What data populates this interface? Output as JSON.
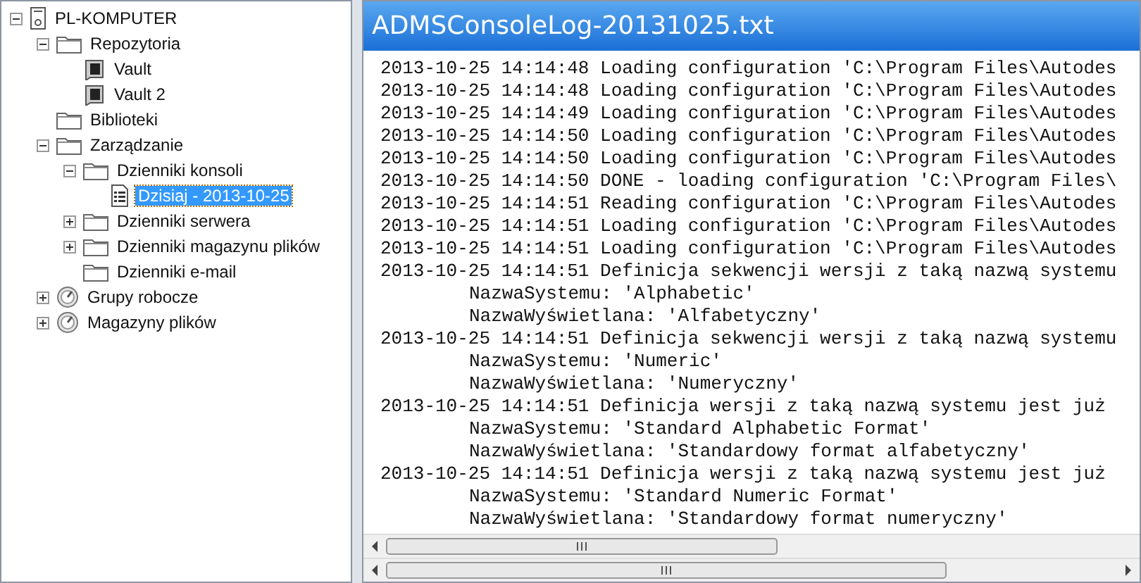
{
  "tree": [
    {
      "label": "PL-KOMPUTER",
      "kind": "computer",
      "expanded": true,
      "selected": false,
      "children": [
        {
          "label": "Repozytoria",
          "kind": "folder",
          "expanded": true,
          "selected": false,
          "children": [
            {
              "label": "Vault",
              "kind": "vault",
              "selected": false
            },
            {
              "label": "Vault 2",
              "kind": "vault",
              "selected": false
            }
          ]
        },
        {
          "label": "Biblioteki",
          "kind": "folder",
          "selected": false
        },
        {
          "label": "Zarządzanie",
          "kind": "folder",
          "expanded": true,
          "selected": false,
          "children": [
            {
              "label": "Dzienniki konsoli",
              "kind": "folder",
              "expanded": true,
              "selected": false,
              "children": [
                {
                  "label": "Dzisiaj - 2013-10-25",
                  "kind": "log",
                  "selected": true
                }
              ]
            },
            {
              "label": "Dzienniki serwera",
              "kind": "folder",
              "expanded": false,
              "selected": false
            },
            {
              "label": "Dzienniki magazynu plików",
              "kind": "folder",
              "expanded": false,
              "selected": false
            },
            {
              "label": "Dzienniki e-mail",
              "kind": "folder",
              "selected": false
            }
          ]
        },
        {
          "label": "Grupy robocze",
          "kind": "disc",
          "expanded": false,
          "selected": false
        },
        {
          "label": "Magazyny plików",
          "kind": "disc",
          "expanded": false,
          "selected": false
        }
      ]
    }
  ],
  "log": {
    "title": "ADMSConsoleLog-20131025.txt",
    "lines": [
      {
        "kind": "entry",
        "text": "2013-10-25 14:14:48 Loading configuration 'C:\\Program Files\\Autodes"
      },
      {
        "kind": "entry",
        "text": "2013-10-25 14:14:48 Loading configuration 'C:\\Program Files\\Autodes"
      },
      {
        "kind": "entry",
        "text": "2013-10-25 14:14:49 Loading configuration 'C:\\Program Files\\Autodes"
      },
      {
        "kind": "entry",
        "text": "2013-10-25 14:14:50 Loading configuration 'C:\\Program Files\\Autodes"
      },
      {
        "kind": "entry",
        "text": "2013-10-25 14:14:50 Loading configuration 'C:\\Program Files\\Autodes"
      },
      {
        "kind": "entry",
        "text": "2013-10-25 14:14:50 DONE - loading configuration 'C:\\Program Files\\"
      },
      {
        "kind": "entry",
        "text": "2013-10-25 14:14:51 Reading configuration 'C:\\Program Files\\Autodes"
      },
      {
        "kind": "entry",
        "text": "2013-10-25 14:14:51 Loading configuration 'C:\\Program Files\\Autodes"
      },
      {
        "kind": "entry",
        "text": "2013-10-25 14:14:51 Loading configuration 'C:\\Program Files\\Autodes"
      },
      {
        "kind": "entry",
        "text": "2013-10-25 14:14:51 Definicja sekwencji wersji z taką nazwą systemu"
      },
      {
        "kind": "detail",
        "text": "NazwaSystemu: 'Alphabetic'"
      },
      {
        "kind": "detail",
        "text": "NazwaWyświetlana: 'Alfabetyczny'"
      },
      {
        "kind": "entry",
        "text": "2013-10-25 14:14:51 Definicja sekwencji wersji z taką nazwą systemu"
      },
      {
        "kind": "detail",
        "text": "NazwaSystemu: 'Numeric'"
      },
      {
        "kind": "detail",
        "text": "NazwaWyświetlana: 'Numeryczny'"
      },
      {
        "kind": "entry",
        "text": "2013-10-25 14:14:51 Definicja wersji z taką nazwą systemu jest już"
      },
      {
        "kind": "detail",
        "text": "NazwaSystemu: 'Standard Alphabetic Format'"
      },
      {
        "kind": "detail",
        "text": "NazwaWyświetlana: 'Standardowy format alfabetyczny'"
      },
      {
        "kind": "entry",
        "text": "2013-10-25 14:14:51 Definicja wersji z taką nazwą systemu jest już"
      },
      {
        "kind": "detail",
        "text": "NazwaSystemu: 'Standard Numeric Format'"
      },
      {
        "kind": "detail",
        "text": "NazwaWyświetlana: 'Standardowy format numeryczny'"
      }
    ]
  }
}
